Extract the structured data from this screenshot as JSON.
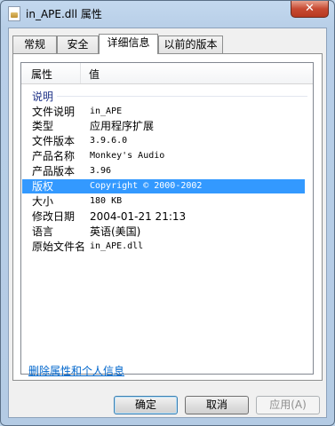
{
  "window": {
    "title": "in_APE.dll 属性",
    "close_glyph": "✕"
  },
  "tabs": [
    "常规",
    "安全",
    "详细信息",
    "以前的版本"
  ],
  "columns": {
    "property": "属性",
    "value": "值"
  },
  "group_label": "说明",
  "rows": [
    {
      "key": "文件说明",
      "value": "in_APE",
      "selected": false
    },
    {
      "key": "类型",
      "value": "应用程序扩展",
      "selected": false
    },
    {
      "key": "文件版本",
      "value": "3.9.6.0",
      "selected": false
    },
    {
      "key": "产品名称",
      "value": "Monkey's Audio",
      "selected": false
    },
    {
      "key": "产品版本",
      "value": "3.96",
      "selected": false
    },
    {
      "key": "版权",
      "value": "Copyright © 2000-2002",
      "selected": true
    },
    {
      "key": "大小",
      "value": "180 KB",
      "selected": false
    },
    {
      "key": "修改日期",
      "value": "2004-01-21 21:13",
      "selected": false
    },
    {
      "key": "语言",
      "value": "英语(美国)",
      "selected": false
    },
    {
      "key": "原始文件名",
      "value": "in_APE.dll",
      "selected": false
    }
  ],
  "remove_link": "删除属性和个人信息",
  "buttons": {
    "ok": "确定",
    "cancel": "取消",
    "apply": "应用(A)"
  },
  "colors": {
    "selection": "#3399ff",
    "link": "#0066cc"
  }
}
